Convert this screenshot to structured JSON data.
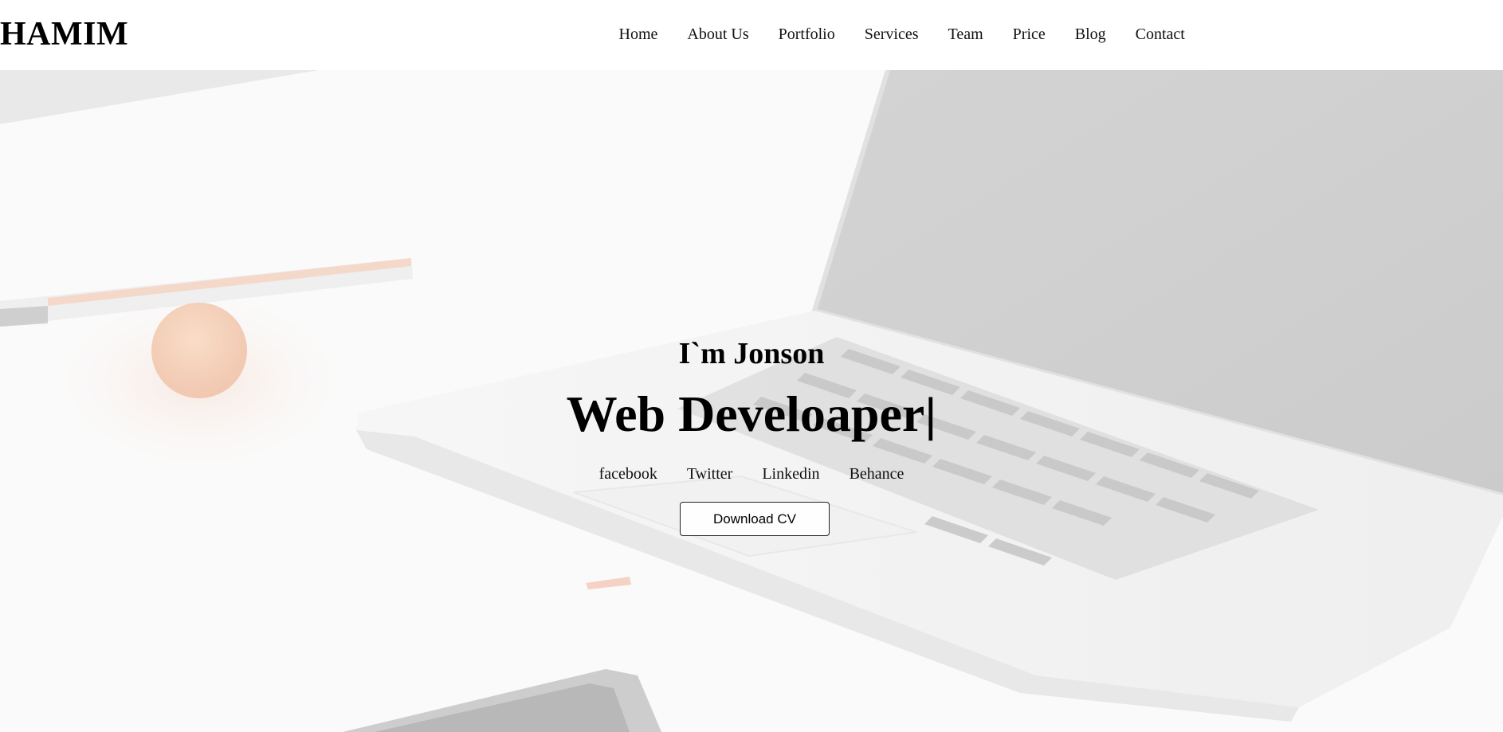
{
  "header": {
    "logo": "HAMIM",
    "nav": [
      "Home",
      "About Us",
      "Portfolio",
      "Services",
      "Team",
      "Price",
      "Blog",
      "Contact"
    ]
  },
  "hero": {
    "greeting": "I`m Jonson",
    "role": "Web Develoaper",
    "cursor": "|",
    "social": [
      "facebook",
      "Twitter",
      "Linkedin",
      "Behance"
    ],
    "cta": "Download CV"
  }
}
